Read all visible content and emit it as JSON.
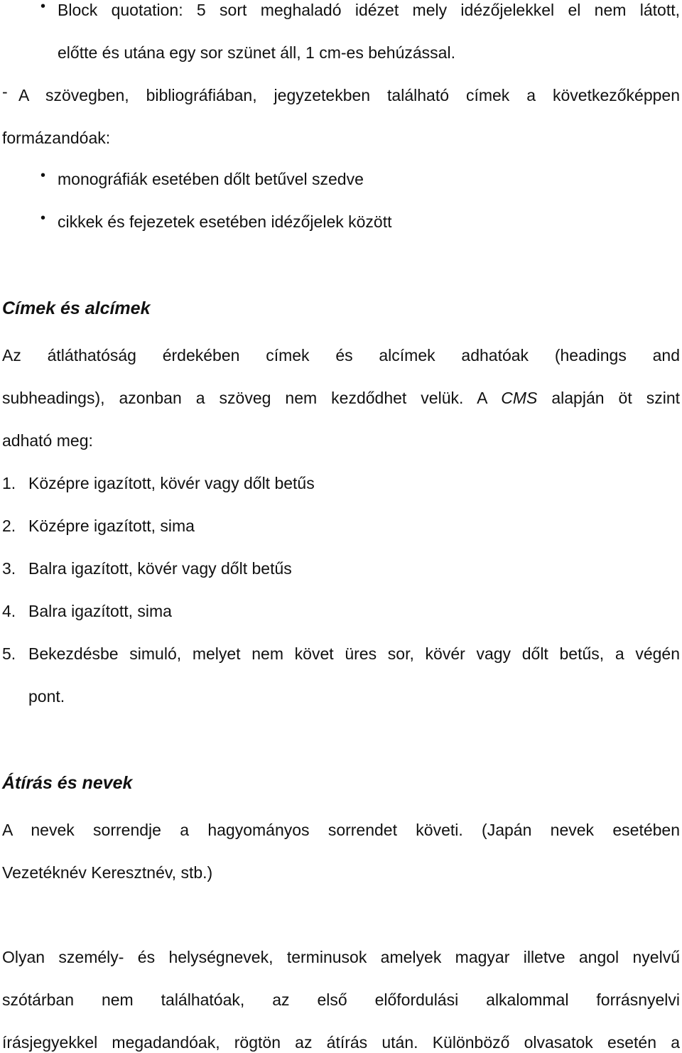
{
  "document": {
    "block_quotation_item": {
      "bullet": "•",
      "line1": "Block quotation: 5 sort meghaladó idézet mely idézőjelekkel el nem látott,",
      "line2": "előtte és utána egy sor szünet áll, 1 cm-es behúzással."
    },
    "titles_rule": {
      "dash": "-",
      "line1": "A szövegben, bibliográfiában, jegyzetekben található címek a következőképpen",
      "line2": "formázandóak:",
      "items": [
        {
          "bullet": "•",
          "text": "monográfiák esetében dőlt betűvel szedve"
        },
        {
          "bullet": "•",
          "text": "cikkek és fejezetek esetében idézőjelek között"
        }
      ]
    },
    "section_headings": {
      "title": "Címek és alcímek",
      "para_line1": "Az átláthatóság érdekében címek és alcímek adhatóak (headings and",
      "para_line2_before": "subheadings), azonban a szöveg nem kezdődhet velük. A ",
      "para_line2_italic": "CMS",
      "para_line2_after": " alapján öt szint",
      "para_line3": "adható meg:",
      "levels": [
        {
          "num": "1.",
          "text": "Középre igazított, kövér vagy dőlt betűs"
        },
        {
          "num": "2.",
          "text": "Középre igazított, sima"
        },
        {
          "num": "3.",
          "text": "Balra igazított, kövér vagy dőlt betűs"
        },
        {
          "num": "4.",
          "text": "Balra igazított, sima"
        },
        {
          "num": "5.",
          "text": "Bekezdésbe simuló, melyet nem követ üres sor, kövér vagy dőlt betűs, a végén",
          "continuation": "pont."
        }
      ]
    },
    "section_names": {
      "title": "Átírás és nevek",
      "para1_line1": "A nevek sorrendje a hagyományos sorrendet követi. (Japán nevek esetében",
      "para1_line2": "Vezetéknév Keresztnév, stb.)",
      "para2_line1": "Olyan személy- és helységnevek, terminusok amelyek magyar illetve angol nyelvű",
      "para2_line2": "szótárban nem találhatóak, az első előfordulási alkalommal forrásnyelvi",
      "para2_line3": "írásjegyekkel megadandóak, rögtön az átírás után. Különböző olvasatok esetén a"
    }
  }
}
